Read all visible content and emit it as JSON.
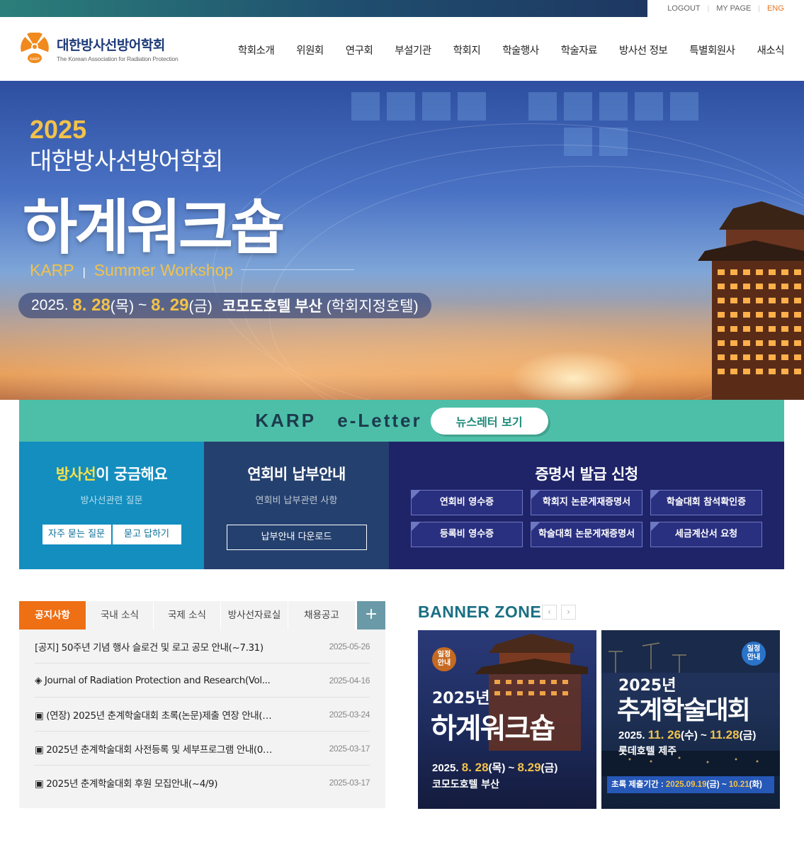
{
  "utility": {
    "logout": "LOGOUT",
    "mypage": "MY PAGE",
    "eng": "ENG"
  },
  "logo": {
    "name_ko": "대한방사선방어학회",
    "name_en": "The Korean Association for Radiation Protection",
    "mark_text": "KARP"
  },
  "nav": {
    "items": [
      "학회소개",
      "위원회",
      "연구회",
      "부설기관",
      "학회지",
      "학술행사",
      "학술자료",
      "방사선 정보",
      "특별회원사",
      "새소식"
    ]
  },
  "hero": {
    "year": "2025",
    "org": "대한방사선방어학회",
    "title": "하계워크숍",
    "sub_a": "KARP",
    "sub_b": "Summer Workshop",
    "date_prefix": "2025.",
    "day1": "8. 28",
    "dow1": "(목)",
    "tilde": "~",
    "day2": "8. 29",
    "dow2": "(금)",
    "place": "코모도호텔 부산",
    "place_note": "(학회지정호텔)"
  },
  "eletter": {
    "title": "KARP   e-Letter",
    "button": "뉴스레터 보기"
  },
  "services": {
    "faq": {
      "title_hl": "방사선",
      "title_rest": "이 궁금해요",
      "desc": "방사선관련 질문",
      "btn_faq": "자주 묻는 질문",
      "btn_qna": "묻고 답하기"
    },
    "fee": {
      "title": "연회비 납부안내",
      "desc": "연회비 납부관련 사항",
      "btn": "납부안내 다운로드"
    },
    "cert": {
      "title": "증명서 발급 신청",
      "items": [
        "연회비 영수증",
        "학회지 논문게재증명서",
        "학술대회 참석확인증",
        "등록비 영수증",
        "학술대회 논문게재증명서",
        "세금계산서 요청"
      ]
    }
  },
  "board": {
    "tabs": [
      "공지사항",
      "국내 소식",
      "국제 소식",
      "방사선자료실",
      "채용공고"
    ],
    "more": "+",
    "notices": [
      {
        "title": "[공지] 50주년 기념 행사 슬로건 및 로고 공모 안내(~7.31)",
        "date": "2025-05-26"
      },
      {
        "title": "◈ Journal of Radiation Protection and Research(Vol...",
        "date": "2025-04-16"
      },
      {
        "title": "▣ (연장) 2025년 춘계학술대회 초록(논문)제출 연장 안내(~...",
        "date": "2025-03-24"
      },
      {
        "title": "▣ 2025년 춘계학술대회 사전등록 및 세부프로그램 안내(04...",
        "date": "2025-03-17"
      },
      {
        "title": "▣ 2025년 춘계학술대회 후원 모집안내(~4/9)",
        "date": "2025-03-17"
      }
    ]
  },
  "banner_zone": {
    "title": "BANNER ZONE",
    "prev": "‹",
    "next": "›",
    "banners": [
      {
        "badge": "일정\n안내",
        "year": "2025년",
        "title": "하계워크숍",
        "date_prefix": "2025.",
        "day1": "8. 28",
        "dow1": "(목)",
        "tilde": "~",
        "day2": "8.29",
        "dow2": "(금)",
        "place": "코모도호텔 부산"
      },
      {
        "badge": "일정\n안내",
        "year": "2025년",
        "title": "추계학술대회",
        "date_prefix": "2025.",
        "day1": "11. 26",
        "dow1": "(수)",
        "tilde": "~",
        "day2": "11.28",
        "dow2": "(금)",
        "place": "롯데호텔 제주",
        "foot_label": "초록 제출기간 :",
        "foot_start": "2025.09.19",
        "foot_start_dow": "(금)",
        "foot_tilde": "~",
        "foot_end": "10.21",
        "foot_end_dow": "(화)"
      }
    ]
  },
  "colors": {
    "accent_orange": "#ee6f14",
    "eletter_green": "#4dbfa8",
    "faq_blue": "#138ebf",
    "fee_navy": "#24406e",
    "cert_indigo": "#1f2468",
    "banner_title": "#1b6f83"
  }
}
